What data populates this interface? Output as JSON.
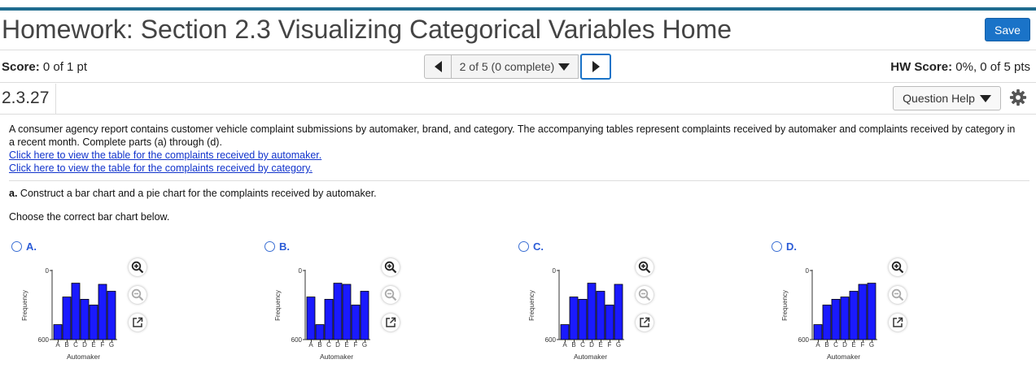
{
  "header": {
    "title": "Homework: Section 2.3 Visualizing Categorical Variables Home",
    "save_label": "Save"
  },
  "status_bar": {
    "score_label": "Score:",
    "score_value": "0 of 1 pt",
    "nav_text": "2 of 5 (0 complete)",
    "hw_score_label": "HW Score:",
    "hw_score_value": "0%, 0 of 5 pts"
  },
  "question": {
    "number": "2.3.27",
    "help_label": "Question Help",
    "intro": "A consumer agency report contains customer vehicle complaint submissions by automaker, brand, and category. The accompanying tables represent complaints received by automaker and complaints received by category in a recent month. Complete parts (a) through (d).",
    "link_automaker": "Click here to view the table for the complaints received by automaker.",
    "link_category": "Click here to view the table for the complaints received by category.",
    "part_a_letter": "a.",
    "part_a_text": " Construct a bar chart and a pie chart for the complaints received by automaker.",
    "instruction": "Choose the correct bar chart below."
  },
  "options": [
    {
      "letter": "A."
    },
    {
      "letter": "B."
    },
    {
      "letter": "C."
    },
    {
      "letter": "D."
    }
  ],
  "colors": {
    "bar": "#1a1aff",
    "accent": "#1a73c8",
    "link": "#1133cc",
    "header_rule": "#1f6c8f"
  },
  "icons": [
    "zoom-in-icon",
    "zoom-out-icon",
    "open-external-icon",
    "gear-icon"
  ],
  "chart_data": [
    {
      "type": "bar",
      "categories": [
        "A",
        "B",
        "C",
        "D",
        "E",
        "F",
        "G"
      ],
      "values": [
        130,
        370,
        490,
        350,
        300,
        480,
        420
      ],
      "xlabel": "Automaker",
      "ylabel": "Frequency",
      "yticks": [
        "0",
        "600"
      ],
      "ylim": [
        0,
        600
      ]
    },
    {
      "type": "bar",
      "categories": [
        "A",
        "B",
        "C",
        "D",
        "E",
        "F",
        "G"
      ],
      "values": [
        370,
        130,
        350,
        490,
        480,
        300,
        420
      ],
      "xlabel": "Automaker",
      "ylabel": "Frequency",
      "yticks": [
        "0",
        "600"
      ],
      "ylim": [
        0,
        600
      ]
    },
    {
      "type": "bar",
      "categories": [
        "A",
        "B",
        "C",
        "D",
        "E",
        "F",
        "G"
      ],
      "values": [
        130,
        370,
        350,
        490,
        420,
        300,
        480
      ],
      "xlabel": "Automaker",
      "ylabel": "Frequency",
      "yticks": [
        "0",
        "600"
      ],
      "ylim": [
        0,
        600
      ]
    },
    {
      "type": "bar",
      "categories": [
        "A",
        "B",
        "C",
        "D",
        "E",
        "F",
        "G"
      ],
      "values": [
        130,
        300,
        350,
        370,
        420,
        480,
        490
      ],
      "xlabel": "Automaker",
      "ylabel": "Frequency",
      "yticks": [
        "0",
        "600"
      ],
      "ylim": [
        0,
        600
      ]
    }
  ]
}
